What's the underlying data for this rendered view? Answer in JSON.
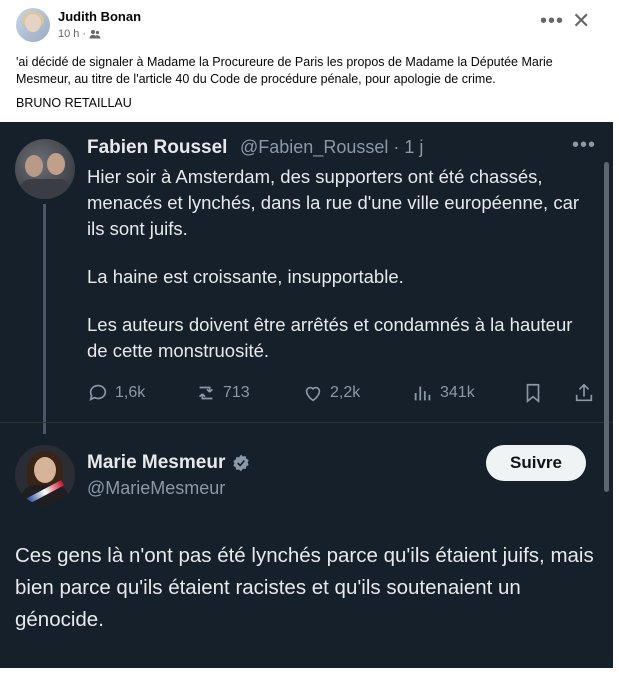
{
  "post": {
    "author": "Judith Bonan",
    "time": "10 h",
    "audience_icon": "friends-icon",
    "text": "'ai décidé de signaler à Madame la Procureure de Paris les propos de Madame la Députée Marie Mesmeur, au titre de l'article 40 du Code de procédure pénale, pour apologie de crime.",
    "signature": "BRUNO RETAILLAU"
  },
  "tweet1": {
    "name": "Fabien Roussel",
    "handle": "@Fabien_Roussel · 1 j",
    "p1": "Hier soir à Amsterdam, des supporters ont été chassés, menacés et lynchés, dans la rue d'une ville européenne, car ils sont juifs.",
    "p2": "La haine est croissante, insupportable.",
    "p3": "Les auteurs doivent être arrêtés et condamnés à la hauteur de cette monstruosité.",
    "replies": "1,6k",
    "reposts": "713",
    "likes": "2,2k",
    "views": "341k"
  },
  "tweet2": {
    "name": "Marie Mesmeur",
    "handle": "@MarieMesmeur",
    "follow_label": "Suivre",
    "text": "Ces gens là n'ont pas été lynchés parce qu'ils étaient juifs, mais bien parce qu'ils étaient racistes et qu'ils soutenaient un génocide."
  }
}
